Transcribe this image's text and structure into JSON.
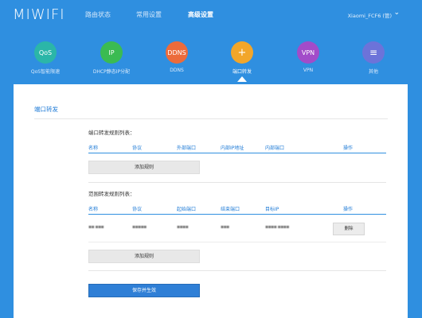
{
  "header": {
    "logo": "MIWIFI",
    "nav": [
      "路由状态",
      "常用设置",
      "高级设置"
    ],
    "router_name": "Xiaomi_FCF6 (管)",
    "router_chevron": "⌄"
  },
  "categories": [
    {
      "icon_text": "QoS",
      "label": "QoS智能限速",
      "color": "#2bb6a8"
    },
    {
      "icon_text": "IP",
      "label": "DHCP静态IP分配",
      "color": "#3bbb52"
    },
    {
      "icon_text": "DDNS",
      "label": "DDNS",
      "color": "#ec6b3b"
    },
    {
      "icon_text": "+",
      "label": "端口转发",
      "color": "#f2a62a"
    },
    {
      "icon_text": "VPN",
      "label": "VPN",
      "color": "#a24cc9"
    },
    {
      "icon_text": "≡",
      "label": "其他",
      "color": "#6c73d9"
    }
  ],
  "panel": {
    "title": "端口转发",
    "port_rules": {
      "title": "端口转发规则列表：",
      "columns": [
        "名称",
        "协议",
        "外部端口",
        "内部IP地址",
        "内部端口",
        "操作"
      ],
      "add_button": "添加规则"
    },
    "range_rules": {
      "title": "范围转发规则列表：",
      "columns": [
        "名称",
        "协议",
        "起始端口",
        "结束端口",
        "目标IP",
        "操作"
      ],
      "rows": [
        {
          "name": "▪▪ ▪▪▪",
          "protocol": "▪▪▪▪▪",
          "start": "▪▪▪▪",
          "end": "▪▪▪",
          "target": "▪▪▪▪ ▪▪▪▪",
          "delete_label": "删除"
        }
      ],
      "add_button": "添加规则"
    },
    "save_button": "保存并生效"
  }
}
